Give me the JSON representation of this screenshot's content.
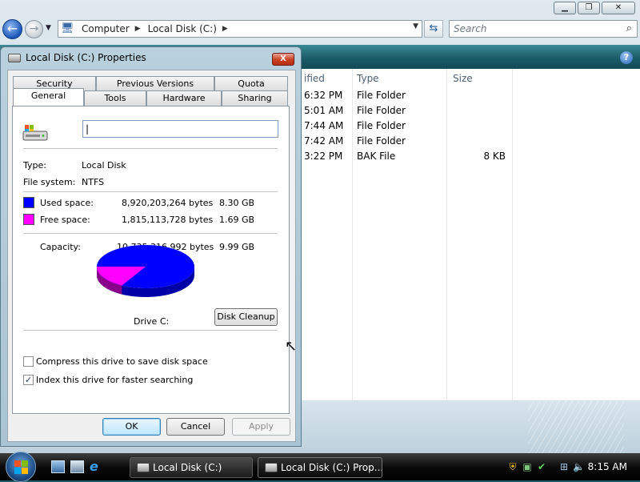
{
  "explorer": {
    "address_crumbs": [
      "Computer",
      "Local Disk (C:)"
    ],
    "search_placeholder": "Search",
    "columns": {
      "modified": "ified",
      "type": "Type",
      "size": "Size"
    },
    "rows": [
      {
        "modified": "6:32 PM",
        "type": "File Folder",
        "size": ""
      },
      {
        "modified": "5:01 AM",
        "type": "File Folder",
        "size": ""
      },
      {
        "modified": "7:44 AM",
        "type": "File Folder",
        "size": ""
      },
      {
        "modified": "7:42 AM",
        "type": "File Folder",
        "size": ""
      },
      {
        "modified": "3:22 PM",
        "type": "BAK File",
        "size": "8 KB"
      }
    ]
  },
  "dialog": {
    "title": "Local Disk (C:) Properties",
    "close_label": "X",
    "tabs_row1": [
      "Security",
      "Previous Versions",
      "Quota"
    ],
    "tabs_row2": [
      "General",
      "Tools",
      "Hardware",
      "Sharing"
    ],
    "active_tab": "General",
    "name_value": "",
    "type_label": "Type:",
    "type_value": "Local Disk",
    "fs_label": "File system:",
    "fs_value": "NTFS",
    "used": {
      "label": "Used space:",
      "bytes": "8,920,203,264 bytes",
      "gb": "8.30 GB",
      "color": "#0000ff"
    },
    "free": {
      "label": "Free space:",
      "bytes": "1,815,113,728 bytes",
      "gb": "1.69 GB",
      "color": "#ff00ff"
    },
    "capacity": {
      "label": "Capacity:",
      "bytes": "10,735,316,992 bytes",
      "gb": "9.99 GB"
    },
    "used_fraction": 0.8309,
    "drive_label": "Drive C:",
    "disk_cleanup_label": "Disk Cleanup",
    "compress_label": "Compress this drive to save disk space",
    "compress_checked": false,
    "index_label": "Index this drive for faster searching",
    "index_checked": true,
    "ok_label": "OK",
    "cancel_label": "Cancel",
    "apply_label": "Apply"
  },
  "taskbar": {
    "tasks": [
      "Local Disk (C:)",
      "Local Disk (C:) Prop..."
    ],
    "clock": "8:15 AM"
  }
}
